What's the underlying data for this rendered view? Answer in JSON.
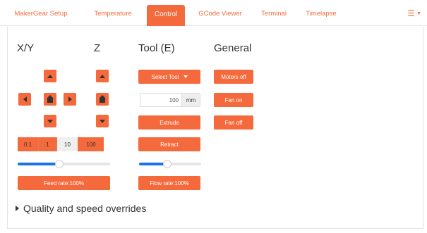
{
  "tabs": [
    {
      "label": "MakerGear Setup",
      "active": false
    },
    {
      "label": "Temperature",
      "active": false
    },
    {
      "label": "Control",
      "active": true
    },
    {
      "label": "GCode Viewer",
      "active": false
    },
    {
      "label": "Terminal",
      "active": false
    },
    {
      "label": "Timelapse",
      "active": false
    }
  ],
  "menu": {
    "icon": "hamburger-icon"
  },
  "columns": {
    "xy": "X/Y",
    "z": "Z",
    "tool": "Tool (E)",
    "general": "General"
  },
  "jog": {
    "icons": {
      "up": "arrow-up-icon",
      "down": "arrow-down-icon",
      "left": "arrow-left-icon",
      "right": "arrow-right-icon",
      "home": "home-icon"
    },
    "step_sizes": [
      {
        "label": "0.1",
        "active": false
      },
      {
        "label": "1",
        "active": false
      },
      {
        "label": "10",
        "active": true
      },
      {
        "label": "100",
        "active": false
      }
    ],
    "feed_rate_label": "Feed rate:100%",
    "feed_rate_level": 0.45
  },
  "tool": {
    "select_label": "Select Tool",
    "amount_value": "100",
    "amount_unit": "mm",
    "extrude_label": "Extrude",
    "retract_label": "Retract",
    "flow_rate_label": "Flow rate:100%",
    "flow_rate_level": 0.45
  },
  "general": {
    "motors_off_label": "Motors off",
    "fan_on_label": "Fan on",
    "fan_off_label": "Fan off"
  },
  "overrides": {
    "label": "Quality and speed overrides"
  },
  "colors": {
    "accent": "#f46a3c",
    "slider_fill": "#1a73e8"
  }
}
